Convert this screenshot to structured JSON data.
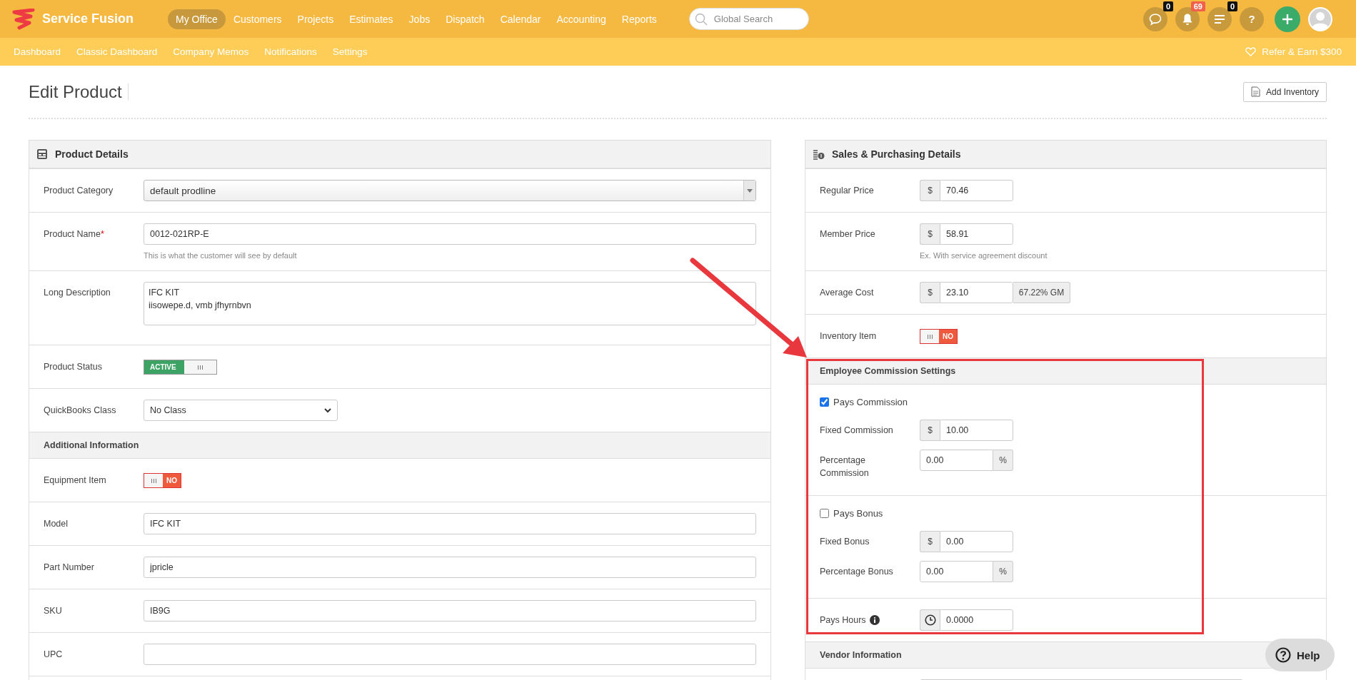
{
  "brand": "Service Fusion",
  "nav": [
    {
      "label": "My Office",
      "selected": true
    },
    {
      "label": "Customers",
      "selected": false
    },
    {
      "label": "Projects",
      "selected": false
    },
    {
      "label": "Estimates",
      "selected": false
    },
    {
      "label": "Jobs",
      "selected": false
    },
    {
      "label": "Dispatch",
      "selected": false
    },
    {
      "label": "Calendar",
      "selected": false
    },
    {
      "label": "Accounting",
      "selected": false
    },
    {
      "label": "Reports",
      "selected": false
    }
  ],
  "search": {
    "placeholder": "Global Search"
  },
  "header_icons": [
    {
      "kind": "chat",
      "badge": "0",
      "color": "#111111"
    },
    {
      "kind": "bell",
      "badge": "69",
      "color": "#f0604a"
    },
    {
      "kind": "list",
      "badge": "0",
      "color": "#111111"
    },
    {
      "kind": "help",
      "text": "?"
    }
  ],
  "subnav": [
    "Dashboard",
    "Classic Dashboard",
    "Company Memos",
    "Notifications",
    "Settings"
  ],
  "refer": "Refer & Earn $300",
  "page": {
    "title": "Edit Product",
    "button": "Add Inventory"
  },
  "product_details": {
    "title": "Product Details",
    "rows": [
      {
        "kind": "select",
        "label": "Product Category",
        "value": "default prodline"
      },
      {
        "kind": "text",
        "label": "Product Name",
        "required_mark": "*",
        "value": "0012-021RP-E",
        "hint": "This is what the customer will see by default"
      },
      {
        "kind": "textarea",
        "label": "Long Description",
        "value": "IFC KIT\niisowepe.d, vmb jfhyrnbvn"
      },
      {
        "kind": "toggle",
        "label": "Product Status",
        "on": true,
        "state_text": "ACTIVE"
      },
      {
        "kind": "dropdown",
        "label": "QuickBooks Class",
        "value": "No Class"
      }
    ]
  },
  "additional_information": {
    "title": "Additional Information",
    "rows": [
      {
        "kind": "toggle",
        "label": "Equipment Item",
        "on": false,
        "state_text": "NO"
      },
      {
        "kind": "text",
        "label": "Model",
        "value": "IFC KIT"
      },
      {
        "kind": "text",
        "label": "Part Number",
        "value": "jpricle"
      },
      {
        "kind": "text",
        "label": "SKU",
        "value": "IB9G"
      },
      {
        "kind": "text",
        "label": "UPC",
        "value": ""
      }
    ]
  },
  "sales": {
    "title": "Sales & Purchasing Details",
    "rows": [
      {
        "kind": "money",
        "label": "Regular Price",
        "prefix": "$",
        "value": "70.46"
      },
      {
        "kind": "money",
        "label": "Member Price",
        "prefix": "$",
        "value": "58.91",
        "hint": "Ex. With service agreement discount"
      },
      {
        "kind": "money",
        "label": "Average Cost",
        "prefix": "$",
        "value": "23.10",
        "suffix": "67.22% GM"
      },
      {
        "kind": "toggle",
        "label": "Inventory Item",
        "on": false,
        "state_text": "NO"
      }
    ]
  },
  "commission": {
    "title": "Employee Commission Settings",
    "groups": [
      {
        "label": "Pays Commission",
        "checked": true,
        "rows": [
          {
            "kind": "money",
            "label": "Fixed Commission",
            "prefix": "$",
            "value": "10.00"
          },
          {
            "kind": "percent",
            "label": "Percentage Commission",
            "value": "0.00",
            "suffix": "%"
          }
        ]
      },
      {
        "label": "Pays Bonus",
        "checked": false,
        "rows": [
          {
            "kind": "money",
            "label": "Fixed Bonus",
            "prefix": "$",
            "value": "0.00"
          },
          {
            "kind": "percent",
            "label": "Percentage Bonus",
            "value": "0.00",
            "suffix": "%"
          }
        ]
      }
    ],
    "pays_hours": {
      "label": "Pays Hours",
      "value": "0.0000"
    }
  },
  "vendor": {
    "title": "Vendor Information"
  },
  "help_button": "Help"
}
